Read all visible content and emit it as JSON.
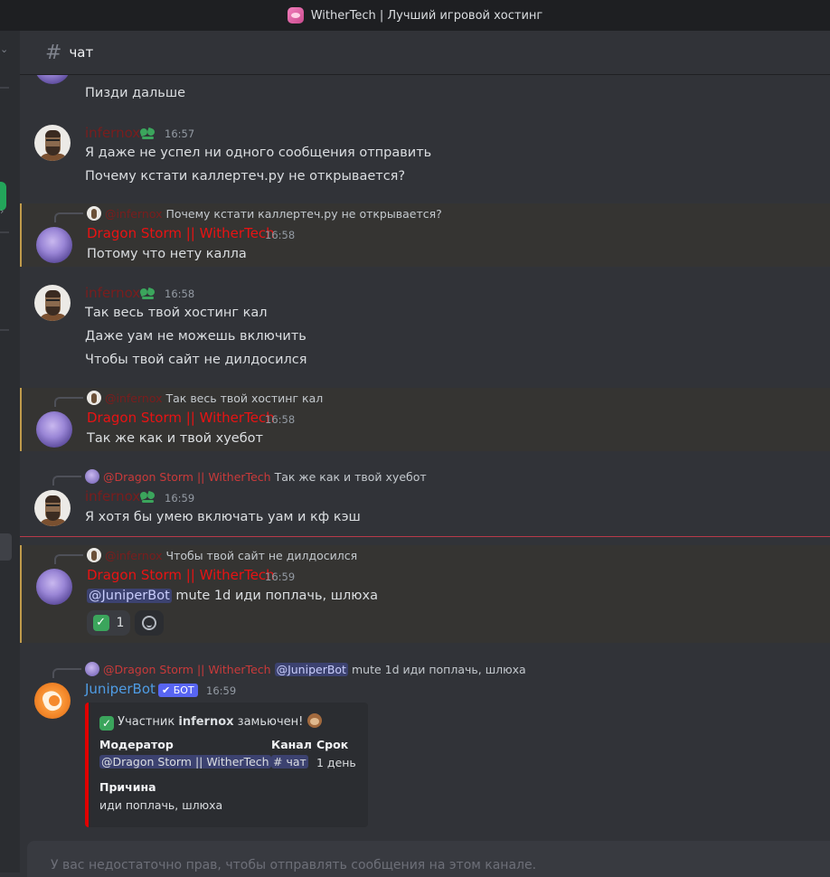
{
  "window": {
    "title": "WitherTech | Лучший игровой хостинг"
  },
  "header": {
    "hash": "#",
    "channel": "чат"
  },
  "messages": {
    "m0": {
      "text": "Пизди дальше"
    },
    "m1": {
      "author": "infernox",
      "time": "16:57",
      "lines": [
        "Я даже не успел ни одного сообщения отправить",
        "Почему кстати каллертеч.ру не открывается?"
      ]
    },
    "m2": {
      "reply_author": "@infernox",
      "reply_text": "Почему кстати каллертеч.ру не открывается?",
      "author": "Dragon Storm || WitherTech",
      "time": "16:58",
      "text": "Потому что нету калла"
    },
    "m3": {
      "author": "infernox",
      "time": "16:58",
      "lines": [
        "Так весь твой хостинг кал",
        "Даже уам не можешь включить",
        "Чтобы твой сайт не дилдосился"
      ]
    },
    "m4": {
      "reply_author": "@infernox",
      "reply_text": "Так весь твой хостинг кал",
      "author": "Dragon Storm || WitherTech",
      "time": "16:58",
      "text": "Так же как и твой хуебот"
    },
    "m5": {
      "reply_author": "@Dragon Storm || WitherTech",
      "reply_text": "Так же как и твой хуебот",
      "author": "infernox",
      "time": "16:59",
      "text": "Я хотя бы умею включать уам и кф кэш"
    },
    "m6": {
      "reply_author": "@infernox",
      "reply_text": "Чтобы твой сайт не дилдосился",
      "author": "Dragon Storm || WitherTech",
      "time": "16:59",
      "mention": "@JuniperBot",
      "text": " mute 1d иди поплачь, шлюха",
      "reaction_count": "1"
    },
    "m7": {
      "reply_author": "@Dragon Storm || WitherTech",
      "reply_mention": "@JuniperBot",
      "reply_text": "mute 1d иди поплачь, шлюха",
      "author": "JuniperBot",
      "bot_tag": "✔ БОТ",
      "time": "16:59",
      "embed": {
        "title_prefix": "Участник ",
        "title_user": "infernox",
        "title_suffix": " замьючен!",
        "moderator_label": "Модератор",
        "moderator_value": "@Dragon Storm || WitherTech",
        "channel_label": "Канал",
        "channel_value": "# чат",
        "term_label": "Срок",
        "term_value": "1 день",
        "reason_label": "Причина",
        "reason_value": "иди поплачь, шлюха"
      }
    }
  },
  "composer": {
    "placeholder": "У вас недостаточно прав, чтобы отправлять сообщения на этом канале."
  },
  "colors": {
    "bg": "#313338",
    "accent": "#5865f2",
    "highlight_border": "#c09b4b",
    "dragon_name": "#e81313",
    "infernox_name": "#7a1d1d",
    "juniper_name": "#4f9ce4",
    "embed_border": "#e00000"
  }
}
